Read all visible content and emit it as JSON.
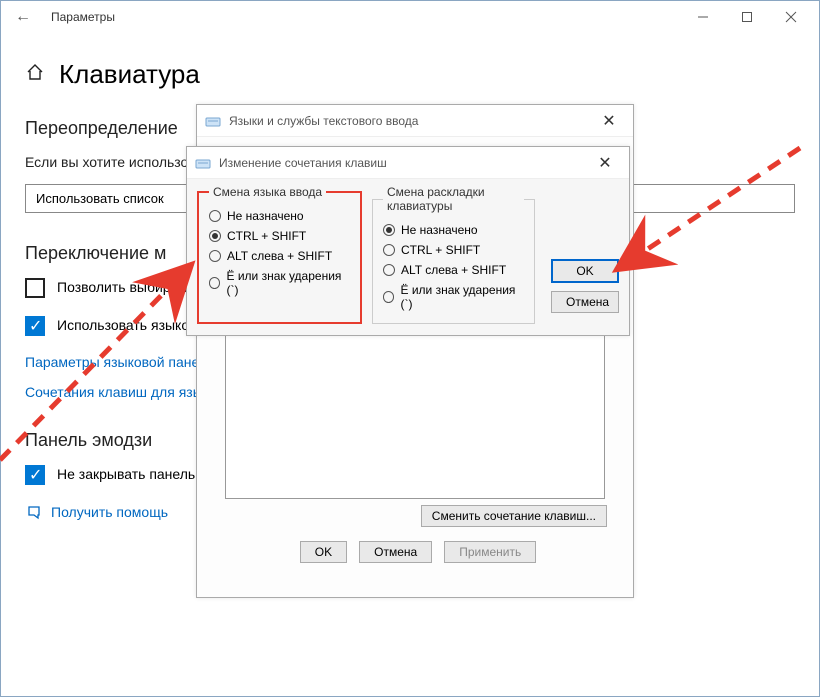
{
  "window": {
    "title": "Параметры"
  },
  "page": {
    "heading": "Клавиатура",
    "section1_title": "Переопределение",
    "section1_body": "Если вы хотите использовать первом месте в вашем с",
    "dropdown": "Использовать список ",
    "section2_title": "Переключение м",
    "chk1_label": "Позволить выбирать м приложения",
    "chk2_label": "Использовать языкову доступна",
    "link1": "Параметры языковой пане",
    "link2": "Сочетания клавиш для язы",
    "section3_title": "Панель эмодзи",
    "chk3_label": "Не закрывать панель автоматически после ввода эмодзи",
    "help_link": "Получить помощь"
  },
  "dlg1": {
    "title": "Языки и службы текстового ввода",
    "change_btn": "Сменить сочетание клавиш...",
    "ok": "OK",
    "cancel": "Отмена",
    "apply": "Применить"
  },
  "dlg2": {
    "title": "Изменение сочетания клавиш",
    "group1_title": "Смена языка ввода",
    "group2_title": "Смена раскладки клавиатуры",
    "opt_none": "Не назначено",
    "opt_ctrlshift": "CTRL + SHIFT",
    "opt_altshift": "ALT слева + SHIFT",
    "opt_accent": "Ё или знак ударения (`)",
    "ok": "OK",
    "cancel": "Отмена"
  }
}
